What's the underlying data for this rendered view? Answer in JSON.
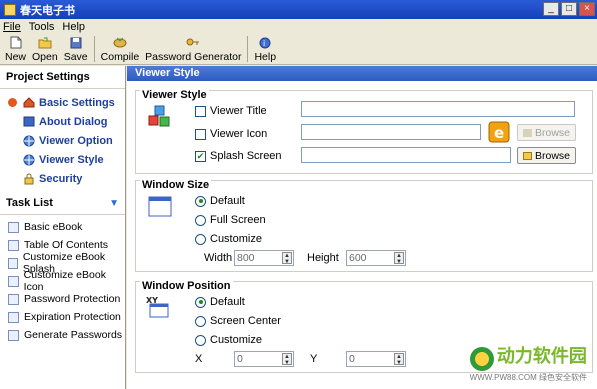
{
  "window": {
    "title": "春天电子书",
    "controls": [
      "_",
      "□",
      "×"
    ]
  },
  "menu": [
    "File",
    "Tools",
    "Help"
  ],
  "toolbar": {
    "new": "New",
    "open": "Open",
    "save": "Save",
    "compile": "Compile",
    "password_generator": "Password Generator",
    "help": "Help"
  },
  "project_settings": {
    "title": "Project Settings",
    "items": [
      {
        "label": "Basic Settings"
      },
      {
        "label": "About Dialog"
      },
      {
        "label": "Viewer Option"
      },
      {
        "label": "Viewer Style"
      },
      {
        "label": "Security"
      }
    ]
  },
  "task_list": {
    "title": "Task List",
    "items": [
      "Basic eBook",
      "Table Of Contents",
      "Customize eBook Splash",
      "Customize eBook Icon",
      "Password Protection",
      "Expiration Protection",
      "Generate Passwords"
    ]
  },
  "main": {
    "header": "Viewer Style",
    "viewer_style": {
      "title": "Viewer Style",
      "viewer_title": {
        "label": "Viewer Title",
        "checked": false,
        "value": ""
      },
      "viewer_icon": {
        "label": "Viewer Icon",
        "checked": false,
        "value": "",
        "browse": "Browse"
      },
      "splash_screen": {
        "label": "Splash Screen",
        "checked": true,
        "value": "",
        "browse": "Browse"
      }
    },
    "window_size": {
      "title": "Window Size",
      "options": [
        "Default",
        "Full Screen",
        "Customize"
      ],
      "selected": "Default",
      "width_label": "Width",
      "width_value": "800",
      "height_label": "Height",
      "height_value": "600"
    },
    "window_position": {
      "title": "Window Position",
      "options": [
        "Default",
        "Screen Center",
        "Customize"
      ],
      "selected": "Default",
      "x_label": "X",
      "x_value": "0",
      "y_label": "Y",
      "y_value": "0"
    }
  },
  "watermark": {
    "main": "动力软件园",
    "sub": "WWW.PW88.COM  绿色安全软件"
  },
  "colors": {
    "accent": "#2d5bc0",
    "link": "#1f3f9c",
    "bullet": "#e05a20",
    "check": "#1c8a1c"
  }
}
